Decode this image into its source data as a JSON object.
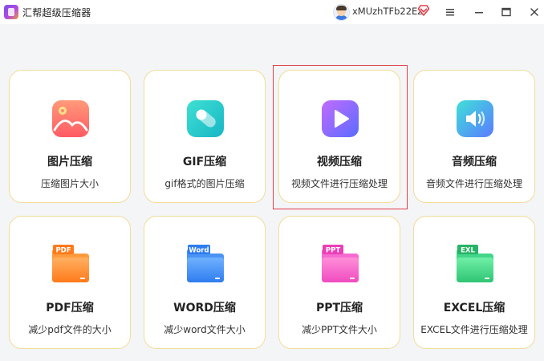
{
  "app": {
    "title": "汇帮超级压缩器"
  },
  "user": {
    "name": "xMUzhTFb22Ez"
  },
  "colors": {
    "card_border": "#f2dc9a",
    "highlight": "#e0404a",
    "vip": "#e0404a"
  },
  "cards": [
    {
      "title": "图片压缩",
      "desc": "压缩图片大小",
      "icon": "image-icon"
    },
    {
      "title": "GIF压缩",
      "desc": "gif格式的图片压缩",
      "icon": "gif-icon"
    },
    {
      "title": "视频压缩",
      "desc": "视频文件进行压缩处理",
      "icon": "video-play-icon"
    },
    {
      "title": "音频压缩",
      "desc": "音频文件进行压缩处理",
      "icon": "speaker-icon"
    },
    {
      "title": "PDF压缩",
      "desc": "减少pdf文件的大小",
      "icon": "pdf-folder-icon",
      "tag": "PDF"
    },
    {
      "title": "WORD压缩",
      "desc": "减少word文件大小",
      "icon": "word-folder-icon",
      "tag": "Word"
    },
    {
      "title": "PPT压缩",
      "desc": "减少PPT文件大小",
      "icon": "ppt-folder-icon",
      "tag": "PPT"
    },
    {
      "title": "EXCEL压缩",
      "desc": "EXCEL文件进行压缩处理",
      "icon": "excel-folder-icon",
      "tag": "EXL"
    }
  ]
}
